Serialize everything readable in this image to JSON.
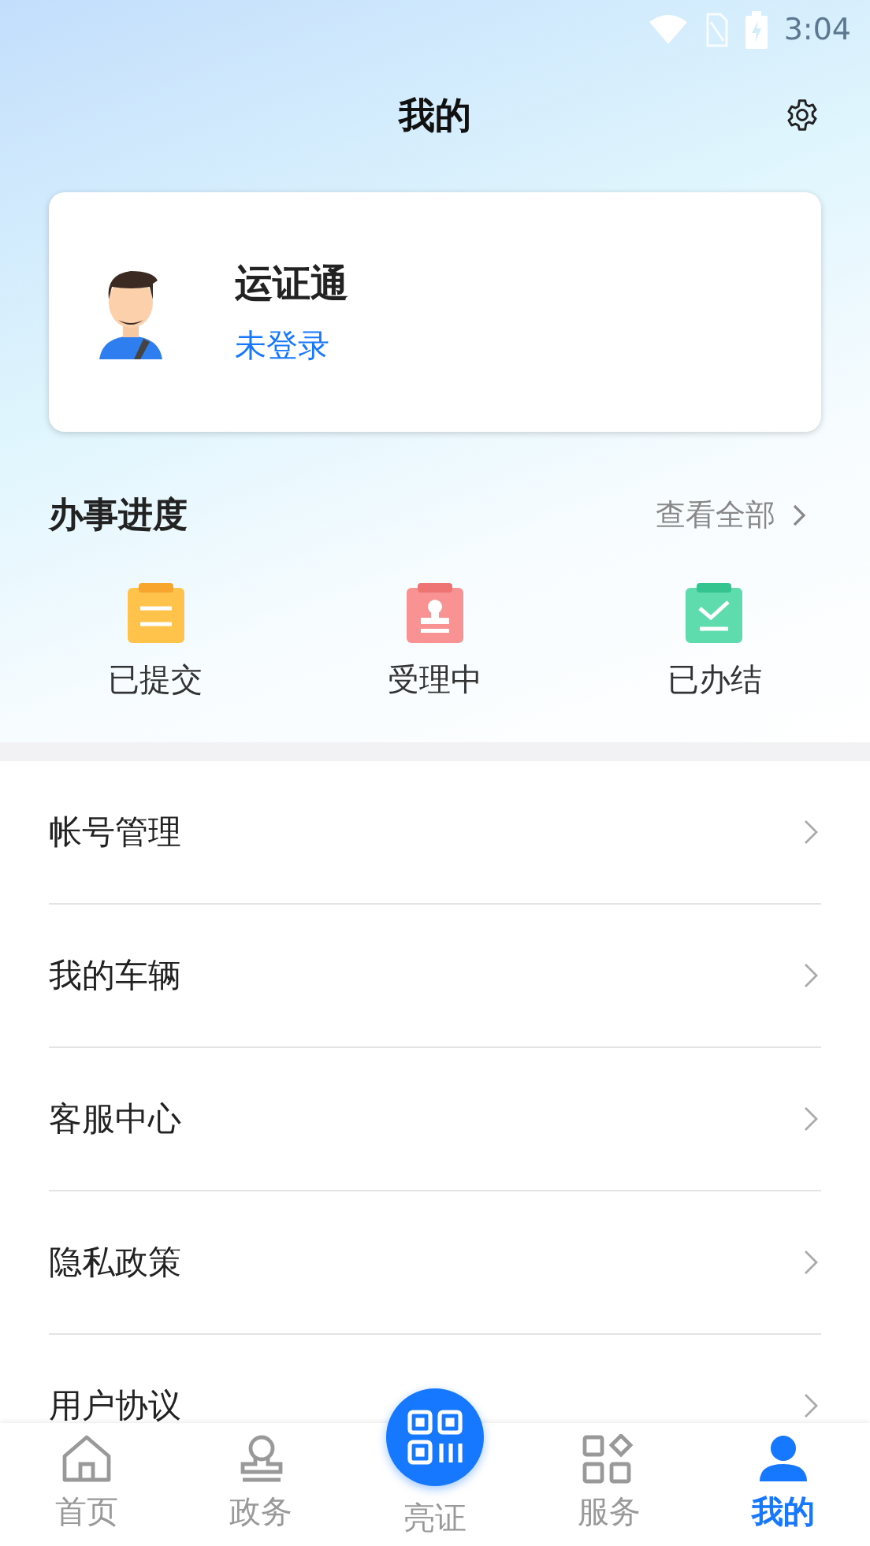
{
  "status_bar": {
    "time": "3:04"
  },
  "header": {
    "title": "我的"
  },
  "profile": {
    "name": "运证通",
    "login_status": "未登录"
  },
  "progress": {
    "title": "办事进度",
    "view_all": "查看全部",
    "items": [
      {
        "kind": "submitted",
        "label": "已提交"
      },
      {
        "kind": "processing",
        "label": "受理中"
      },
      {
        "kind": "completed",
        "label": "已办结"
      }
    ]
  },
  "menu": [
    {
      "label": "帐号管理"
    },
    {
      "label": "我的车辆"
    },
    {
      "label": "客服中心"
    },
    {
      "label": "隐私政策"
    },
    {
      "label": "用户协议"
    }
  ],
  "tab_bar": [
    {
      "kind": "home",
      "label": "首页",
      "selected": false
    },
    {
      "kind": "affairs",
      "label": "政务",
      "selected": false
    },
    {
      "kind": "qr",
      "label": "亮证",
      "selected": false
    },
    {
      "kind": "services",
      "label": "服务",
      "selected": false
    },
    {
      "kind": "me",
      "label": "我的",
      "selected": true
    }
  ]
}
